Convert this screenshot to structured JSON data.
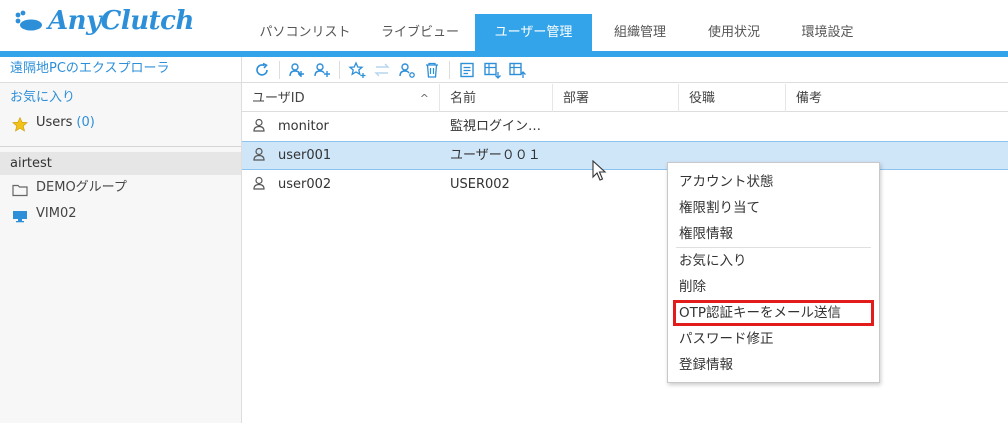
{
  "app": {
    "name": "AnyClutch",
    "accent": "#34a4ea"
  },
  "tabs": [
    {
      "label": "パソコンリスト",
      "active": false
    },
    {
      "label": "ライブビュー",
      "active": false
    },
    {
      "label": "ユーザー管理",
      "active": true
    },
    {
      "label": "組織管理",
      "active": false
    },
    {
      "label": "使用状況",
      "active": false
    },
    {
      "label": "環境設定",
      "active": false
    }
  ],
  "sidebar": {
    "explorer": "遠隔地PCのエクスプローラ",
    "favorites_title": "お気に入り",
    "users_label": "Users",
    "users_count": "(0)",
    "org_name": "airtest",
    "items": [
      {
        "label": "DEMOグループ",
        "icon": "folder-icon"
      },
      {
        "label": "VIM02",
        "icon": "monitor-icon"
      }
    ]
  },
  "toolbar": {
    "buttons": [
      "refresh-icon",
      "add-group-icon",
      "add-user-icon",
      "favorite-add-icon",
      "transfer-icon",
      "user-settings-icon",
      "delete-icon",
      "list-icon",
      "import-icon",
      "export-icon"
    ]
  },
  "table": {
    "columns": [
      "ユーザID",
      "名前",
      "部署",
      "役職",
      "備考"
    ],
    "sort_indicator": "^",
    "rows": [
      {
        "id": "monitor",
        "name": "監視ログイン…",
        "dept": "",
        "title": "",
        "note": "",
        "selected": false
      },
      {
        "id": "user001",
        "name": "ユーザー００１",
        "dept": "",
        "title": "",
        "note": "",
        "selected": true
      },
      {
        "id": "user002",
        "name": "USER002",
        "dept": "",
        "title": "",
        "note": "",
        "selected": false
      }
    ]
  },
  "context_menu": {
    "items": [
      "アカウント状態",
      "権限割り当て",
      "権限情報",
      "お気に入り",
      "削除",
      "OTP認証キーをメール送信",
      "パスワード修正",
      "登録情報"
    ]
  }
}
